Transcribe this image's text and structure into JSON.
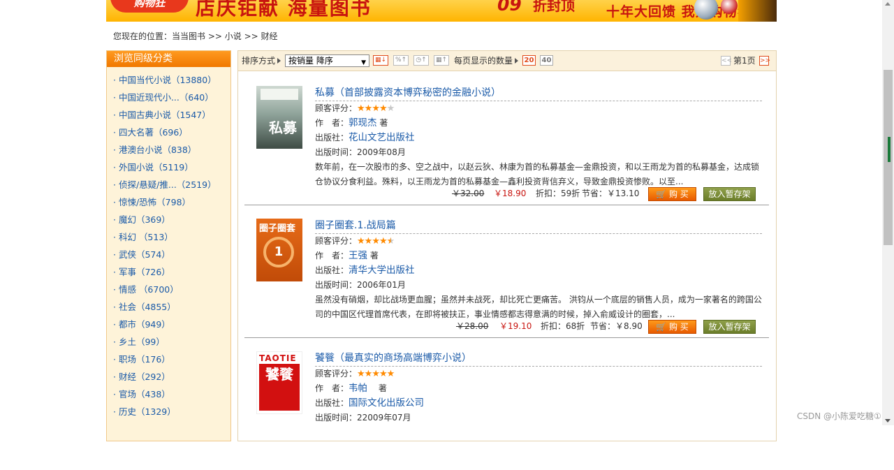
{
  "banner": {
    "logo": "购物狂",
    "text1": "店庆钜献 海量图书",
    "text2": "09",
    "text3": "折封顶",
    "text4": "十年大回馈 我为购物狂"
  },
  "breadcrumb": {
    "prefix": "您现在的位置：",
    "items": [
      "当当图书",
      "小说",
      "财经"
    ],
    "separator": " >> "
  },
  "sidebar": {
    "title": "浏览同级分类",
    "items": [
      {
        "label": "· 中国当代小说（13880）"
      },
      {
        "label": "· 中国近现代小...（640）"
      },
      {
        "label": "· 中国古典小说（1547）"
      },
      {
        "label": "· 四大名著（696）"
      },
      {
        "label": "· 港澳台小说（838）"
      },
      {
        "label": "· 外国小说（5119）"
      },
      {
        "label": "· 侦探/悬疑/推...（2519）"
      },
      {
        "label": "· 惊悚/恐怖（798）"
      },
      {
        "label": "· 魔幻（369）"
      },
      {
        "label": "· 科幻 （513）"
      },
      {
        "label": "· 武侠（574）"
      },
      {
        "label": "· 军事（726）"
      },
      {
        "label": "· 情感 （6700）"
      },
      {
        "label": "· 社会（4855）"
      },
      {
        "label": "· 都市（949）"
      },
      {
        "label": "· 乡土（99）"
      },
      {
        "label": "· 职场（176）"
      },
      {
        "label": "· 财经（292）"
      },
      {
        "label": "· 官场（438）"
      },
      {
        "label": "· 历史（1329）"
      }
    ]
  },
  "toolbar": {
    "sort_label": "排序方式",
    "sort_value": "按销量 降序",
    "per_page_label": "每页显示的数量",
    "per_page_options": [
      "20",
      "40"
    ],
    "per_page_selected": "20",
    "page_label": "第1页",
    "prev": "<<",
    "next": ">>"
  },
  "books": [
    {
      "title": "私募（首部披露资本博弈秘密的金融小说）",
      "rating_label": "顾客评分：",
      "rating": 4,
      "stars_full": "★★★★",
      "stars_empty": "★",
      "author_label": "作　者：",
      "author": "郭现杰",
      "author_suffix": " 著",
      "publisher_label": "出版社：",
      "publisher": "花山文艺出版社",
      "date_label": "出版时间：",
      "date": "2009年08月",
      "description": "数年前，在一次股市的多、空之战中，以赵云狄、林康为首的私募基金—金鼎投资，和以王雨龙为首的私募基金，达成锁仓协议分食利益。殊料，以王雨龙为首的私募基金—鑫利投资背信弃义，导致金鼎投资惨败。以至...",
      "original_price": "￥32.00",
      "current_price": "￥18.90",
      "discount": "折扣：59折",
      "saving": "节省：￥13.10",
      "buy_label": "购 买",
      "shelf_label": "放入暂存架",
      "cover_text": "私募"
    },
    {
      "title": "圈子圈套.1.战局篇",
      "rating_label": "顾客评分：",
      "rating": 4.5,
      "stars_full": "★★★★",
      "stars_half": "★",
      "author_label": "作　者：",
      "author": "王强",
      "author_suffix": " 著",
      "publisher_label": "出版社：",
      "publisher": "清华大学出版社",
      "date_label": "出版时间：",
      "date": "2006年01月",
      "description": "虽然没有硝烟，却比战场更血腥；虽然并未战死，却比死亡更痛苦。 洪钧从一个底层的销售人员，成为一家著名的跨国公司的中国区代理首席代表，在即将被扶正，事业情感都志得意满的时候，掉入俞威设计的圈套，...",
      "original_price": "￥28.00",
      "current_price": "￥19.10",
      "discount": "折扣：68折",
      "saving": "节省：￥8.90",
      "buy_label": "购 买",
      "shelf_label": "放入暂存架",
      "cover_text": "圈子圈套",
      "cover_num": "1"
    },
    {
      "title": "饕餮（最真实的商场高端博弈小说）",
      "rating_label": "顾客评分：",
      "rating": 5,
      "stars_full": "★★★★★",
      "author_label": "作　者：",
      "author": "韦帕",
      "author_suffix": "　 著",
      "publisher_label": "出版社：",
      "publisher": "国际文化出版公司",
      "date_label": "出版时间：",
      "date": "22009年07月",
      "cover_text": "TAOTIE",
      "cover_main": "饕餮"
    }
  ],
  "watermark": "CSDN @小陈爱吃糖①",
  "colors": {
    "link": "#1a5aa8",
    "price": "#c8140f",
    "sidebar_bg": "#fef3d9",
    "sidebar_header": "#f07800",
    "star": "#ff8a00",
    "buy_button": "#e85a00",
    "shelf_button": "#6b7d2a"
  }
}
